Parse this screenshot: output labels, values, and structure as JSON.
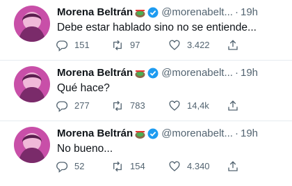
{
  "author": {
    "name": "Morena Beltrán",
    "emoji": "stadium-emoji",
    "verified_icon": "verified-badge-icon"
  },
  "colors": {
    "text": "#0f1419",
    "secondary": "#536471",
    "verified": "#1d9bf0",
    "border": "#e6ecf0"
  },
  "tweets": [
    {
      "handle": "@morenabelt...",
      "time": "19h",
      "text": "Debe estar hablado sino no se entiende...",
      "replies": "151",
      "retweets": "97",
      "likes": "3.422"
    },
    {
      "handle": "@morenabelt...",
      "time": "19h",
      "text": "Qué hace?",
      "replies": "277",
      "retweets": "783",
      "likes": "14,4k"
    },
    {
      "handle": "@morenabelt...",
      "time": "19h",
      "text": "No bueno...",
      "replies": "52",
      "retweets": "154",
      "likes": "4.340"
    }
  ],
  "separator": "·"
}
